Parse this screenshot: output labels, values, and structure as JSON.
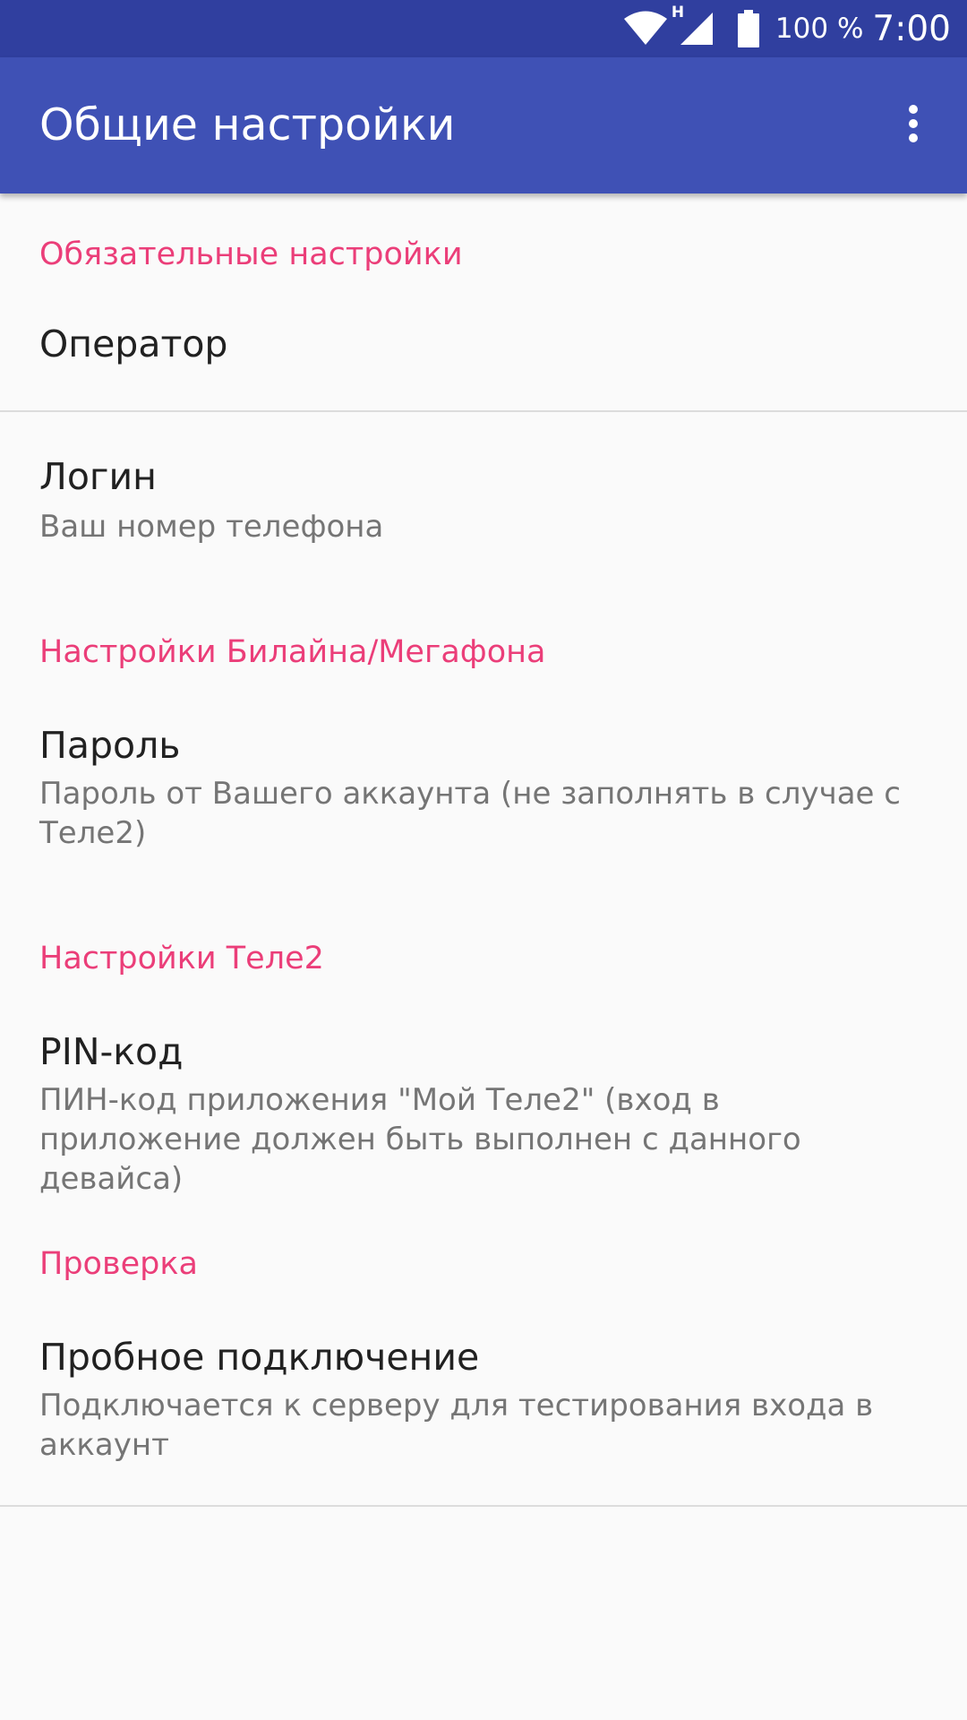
{
  "status_bar": {
    "network_type": "H",
    "battery_percent": "100 %",
    "time": "7:00",
    "icons": [
      "wifi-icon",
      "cell-signal-icon",
      "battery-icon"
    ]
  },
  "app_bar": {
    "title": "Общие настройки",
    "menu_icon": "overflow-menu-icon"
  },
  "sections": {
    "required": {
      "header": "Обязательные настройки",
      "operator": {
        "title": "Оператор"
      },
      "login": {
        "title": "Логин",
        "summary": "Ваш номер телефона"
      }
    },
    "beeline_megafon": {
      "header": "Настройки Билайна/Мегафона",
      "password": {
        "title": "Пароль",
        "summary": "Пароль от Вашего аккаунта (не заполнять в случае с Теле2)"
      }
    },
    "tele2": {
      "header": "Настройки Теле2",
      "pin": {
        "title": "PIN-код",
        "summary": "ПИН-код приложения \"Мой Теле2\" (вход в приложение должен быть выполнен с данного девайса)"
      }
    },
    "check": {
      "header": "Проверка",
      "test_connection": {
        "title": "Пробное подключение",
        "summary": "Подключается к серверу для тестирования входа в аккаунт"
      }
    }
  },
  "colors": {
    "status_bar": "#303f9f",
    "app_bar": "#3f51b5",
    "accent": "#e91e63",
    "background": "#fafafa"
  }
}
